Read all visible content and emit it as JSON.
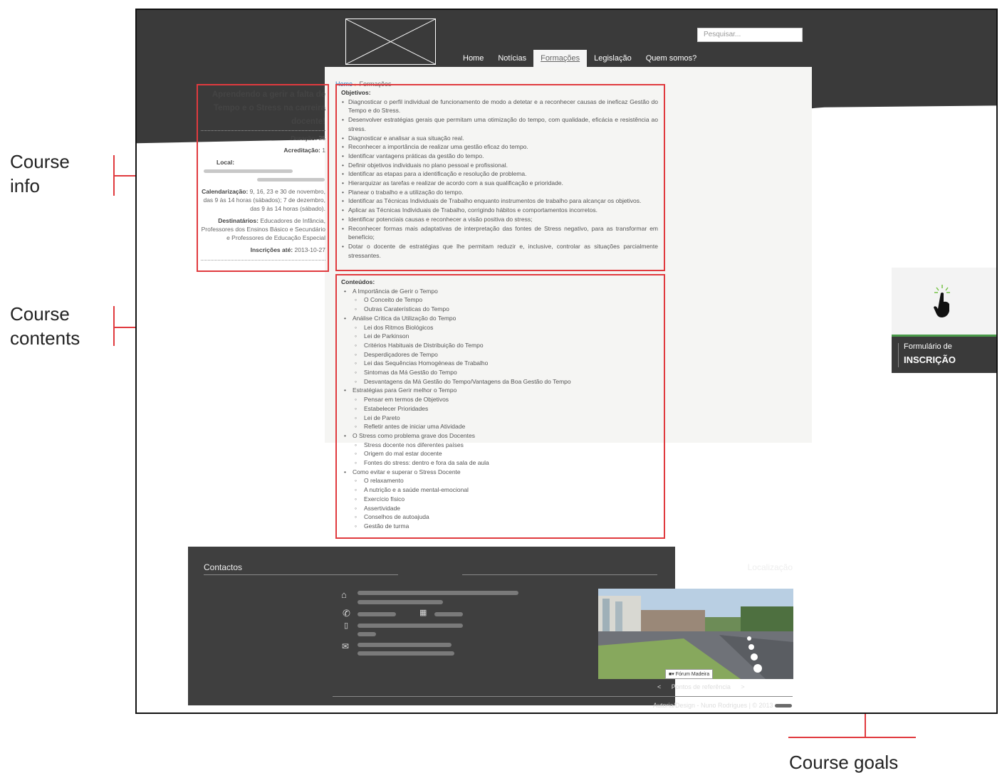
{
  "annotations": {
    "course_info": [
      "Course",
      "info"
    ],
    "course_contents": [
      "Course",
      "contents"
    ],
    "course_goals": "Course goals"
  },
  "header": {
    "search_placeholder": "Pesquisar...",
    "nav": [
      "Home",
      "Notícias",
      "Formações",
      "Legislação",
      "Quem somos?"
    ],
    "active_nav": "Formações"
  },
  "breadcrumb": {
    "home": "Home",
    "current": "Formações"
  },
  "course_info": {
    "title": "Aprendendo a gerir a falta de Tempo e o Stress na carreira docente!",
    "duracao_label": "Duração:",
    "duracao_value": "25",
    "acreditacao_label": "Acreditação:",
    "acreditacao_value": "1",
    "local_label": "Local:",
    "calendarizacao_label": "Calendarização:",
    "calendarizacao_value": "9, 16, 23 e 30 de novembro, das 9 às 14 horas (sábados); 7 de dezembro, das 9 às 14 horas (sábado).",
    "destinatarios_label": "Destinatários:",
    "destinatarios_value": "Educadores de Infância, Professores dos Ensinos Básico e Secundário e Professores de Educação Especial",
    "inscricoes_label": "Inscrições até:",
    "inscricoes_value": "2013-10-27"
  },
  "objetivos": {
    "title": "Objetivos:",
    "items": [
      "Diagnosticar o perfil individual de funcionamento de modo a detetar e a reconhecer causas de ineficaz Gestão do Tempo e do Stress.",
      "Desenvolver estratégias gerais que permitam uma otimização do tempo, com qualidade, eficácia e resistência ao stress.",
      "Diagnosticar e analisar a sua situação real.",
      "Reconhecer a importância de realizar uma gestão eficaz do tempo.",
      "Identificar vantagens práticas da gestão do tempo.",
      "Definir objetivos individuais no plano pessoal e profissional.",
      "Identificar as etapas para a identificação e resolução de problema.",
      "Hierarquizar as tarefas e realizar de acordo com a sua qualificação e prioridade.",
      "Planear o trabalho e a utilização do tempo.",
      "Identificar as Técnicas Individuais de Trabalho enquanto instrumentos de trabalho para alcançar os objetivos.",
      "Aplicar as Técnicas Individuais de Trabalho, corrigindo hábitos e comportamentos incorretos.",
      "Identificar potenciais causas e reconhecer a visão positiva do stress;",
      "Reconhecer formas mais adaptativas de interpretação das fontes de Stress negativo, para as transformar em benefício;",
      "Dotar o docente de estratégias que lhe permitam reduzir e, inclusive, controlar as situações parcialmente stressantes."
    ]
  },
  "conteudos": {
    "title": "Conteúdos:",
    "topics": [
      {
        "label": "A Importância de Gerir o Tempo",
        "subs": [
          "O Conceito de Tempo",
          "Outras Caraterísticas do Tempo"
        ]
      },
      {
        "label": "Análise Crítica da Utilização do Tempo",
        "subs": [
          "Lei dos Ritmos Biológicos",
          "Lei de Parkinson",
          "Critérios Habituais de Distribuição do Tempo",
          "Desperdiçadores de Tempo",
          "Lei das Sequências Homogéneas de Trabalho",
          "Sintomas da Má Gestão do Tempo",
          "Desvantagens da Má Gestão do Tempo/Vantagens da Boa Gestão do Tempo"
        ]
      },
      {
        "label": "Estratégias para Gerir melhor o Tempo",
        "subs": [
          "Pensar em termos de Objetivos",
          "Estabelecer Prioridades",
          "Lei de Pareto",
          "Refletir antes de iniciar uma Atividade"
        ]
      },
      {
        "label": "O Stress como problema grave dos Docentes",
        "subs": [
          "Stress docente nos diferentes países",
          "Origem do mal estar docente",
          "Fontes do stress: dentro e fora da sala de aula"
        ]
      },
      {
        "label": "Como evitar e superar o Stress Docente",
        "subs": [
          "O relaxamento",
          "A nutrição e a saúde mental-emocional",
          "Exercício físico",
          "Assertividade",
          "Conselhos de autoajuda",
          "Gestão de turma"
        ]
      }
    ]
  },
  "footer": {
    "contactos": "Contactos",
    "localizacao": "Localização",
    "map_caption": "Fórum Madeira",
    "map_nav_prev": "<",
    "map_nav_label": "Pontos de referência",
    "map_nav_next": ">",
    "credits": "Autoria/Design - Nuno Rodrigues  |  © 2013"
  },
  "registration_widget": {
    "line1": "Formulário de",
    "line2": "INSCRIÇÃO"
  },
  "colors": {
    "annotation_red": "#e03a3e",
    "header_dark": "#3a3a3a",
    "link_blue": "#2a7bc0"
  }
}
